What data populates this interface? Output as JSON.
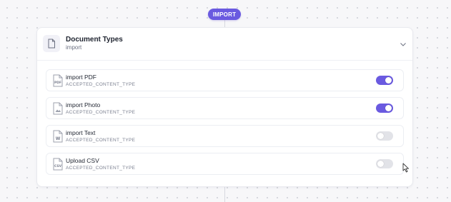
{
  "pill": {
    "label": "IMPORT"
  },
  "panel": {
    "title": "Document Types",
    "subtitle": "import",
    "icon": "document-icon",
    "expand_icon": "chevron-down-icon"
  },
  "items": [
    {
      "title": "import PDF",
      "subtitle": "ACCEPTED_CONTENT_TYPE",
      "icon": "pdf-file-icon",
      "icon_badge": "PDF",
      "enabled": true
    },
    {
      "title": "import Photo",
      "subtitle": "ACCEPTED_CONTENT_TYPE",
      "icon": "image-file-icon",
      "icon_badge": "",
      "enabled": true
    },
    {
      "title": "import Text",
      "subtitle": "ACCEPTED_CONTENT_TYPE",
      "icon": "word-file-icon",
      "icon_badge": "W",
      "enabled": false
    },
    {
      "title": "Upload CSV",
      "subtitle": "ACCEPTED_CONTENT_TYPE",
      "icon": "csv-file-icon",
      "icon_badge": "CSV",
      "enabled": false
    }
  ],
  "colors": {
    "accent": "#6a5ae0",
    "toggle_off": "#e2e3e8"
  }
}
